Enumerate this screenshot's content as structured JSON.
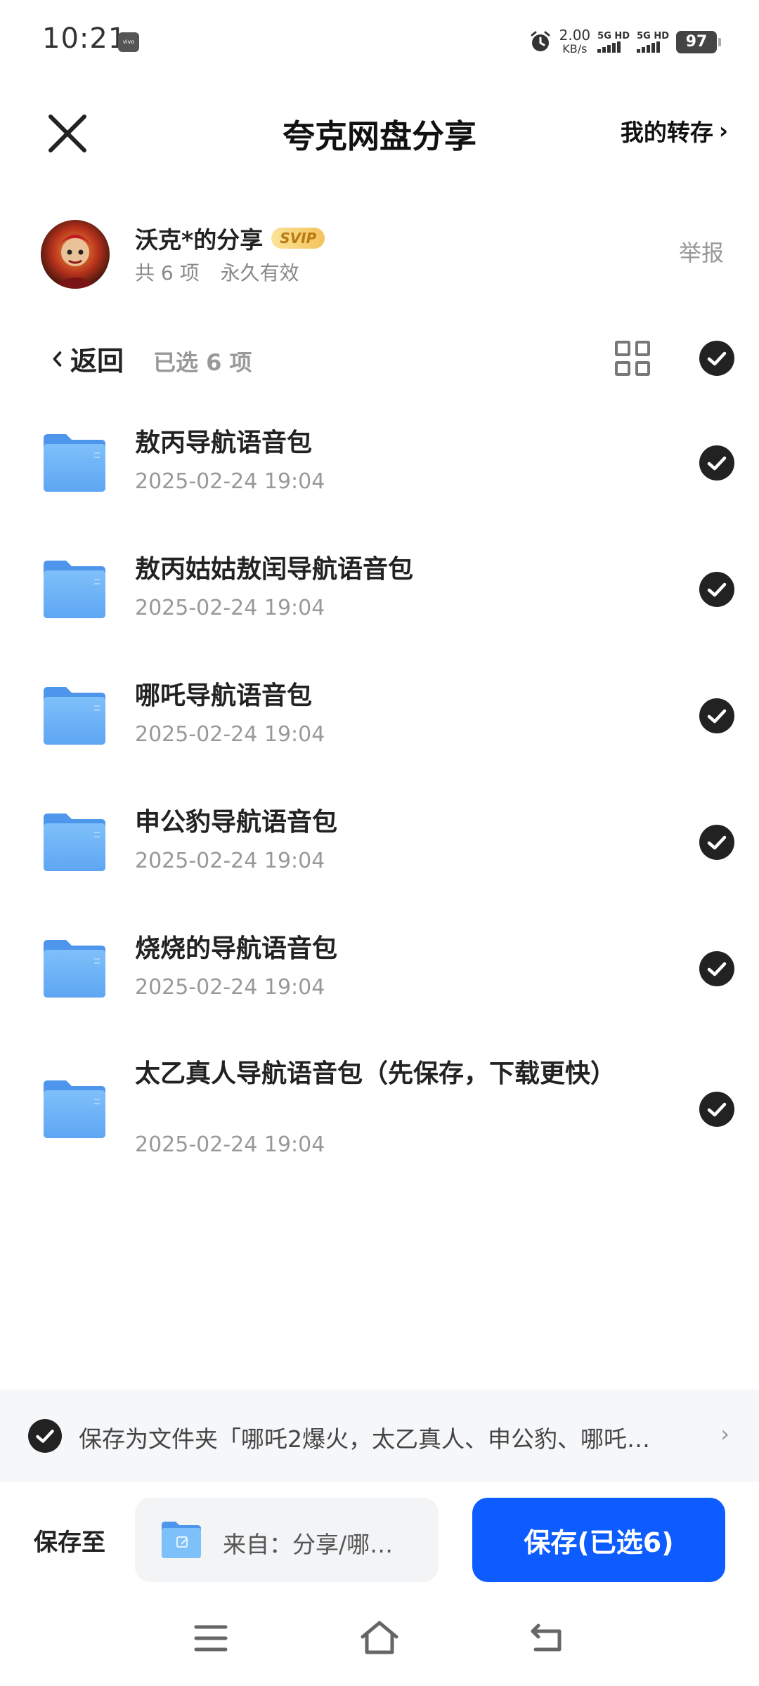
{
  "status": {
    "time": "10:21",
    "speed_value": "2.00",
    "speed_unit": "KB/s",
    "sim1": "5G HD",
    "sim2": "5G HD",
    "battery": "97",
    "brand": "vivo"
  },
  "header": {
    "title": "夸克网盘分享",
    "my_transfer": "我的转存",
    "chevron": "›"
  },
  "share": {
    "owner": "沃克*的分享",
    "badge": "SVIP",
    "count": "共 6 项",
    "validity": "永久有效",
    "report": "举报"
  },
  "toolbar": {
    "back": "返回",
    "selected": "已选 6 项"
  },
  "files": [
    {
      "name": "敖丙导航语音包",
      "date": "2025-02-24 19:04"
    },
    {
      "name": "敖丙姑姑敖闰导航语音包",
      "date": "2025-02-24 19:04"
    },
    {
      "name": "哪吒导航语音包",
      "date": "2025-02-24 19:04"
    },
    {
      "name": "申公豹导航语音包",
      "date": "2025-02-24 19:04"
    },
    {
      "name": "烧烧的导航语音包",
      "date": "2025-02-24 19:04"
    },
    {
      "name": "太乙真人导航语音包（先保存，下载更快）",
      "date": "2025-02-24 19:04"
    }
  ],
  "save_folder": {
    "text": "保存为文件夹「哪吒2爆火，太乙真人、申公豹、哪吒…",
    "chevron": "›"
  },
  "bottom": {
    "save_to": "保存至",
    "destination": "来自：分享/哪…",
    "save_button": "保存(已选6)"
  },
  "colors": {
    "accent": "#0d5cff",
    "folder": "#6fb3f7",
    "check": "#222222"
  }
}
